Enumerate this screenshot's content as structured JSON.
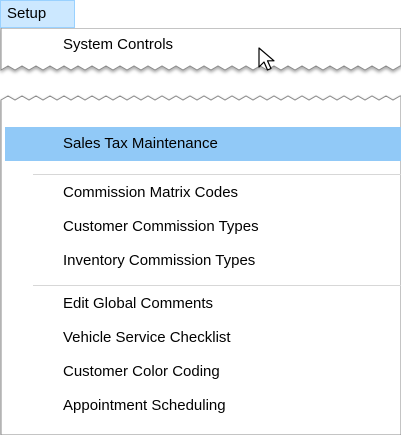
{
  "menu": {
    "title": "Setup"
  },
  "top_items": [
    {
      "label": "System Controls"
    }
  ],
  "highlighted_item": {
    "label": "Sales Tax Maintenance"
  },
  "group_commission": [
    {
      "label": "Commission Matrix Codes"
    },
    {
      "label": "Customer Commission Types"
    },
    {
      "label": "Inventory Commission Types"
    }
  ],
  "group_misc": [
    {
      "label": "Edit Global Comments"
    },
    {
      "label": "Vehicle Service Checklist"
    },
    {
      "label": "Customer Color Coding"
    },
    {
      "label": "Appointment Scheduling"
    }
  ],
  "colors": {
    "menu_title_bg": "#cce8ff",
    "highlight_bg": "#91c9f7",
    "separator": "#d7d7d7"
  },
  "icons": {
    "cursor": "mouse-pointer-icon"
  }
}
